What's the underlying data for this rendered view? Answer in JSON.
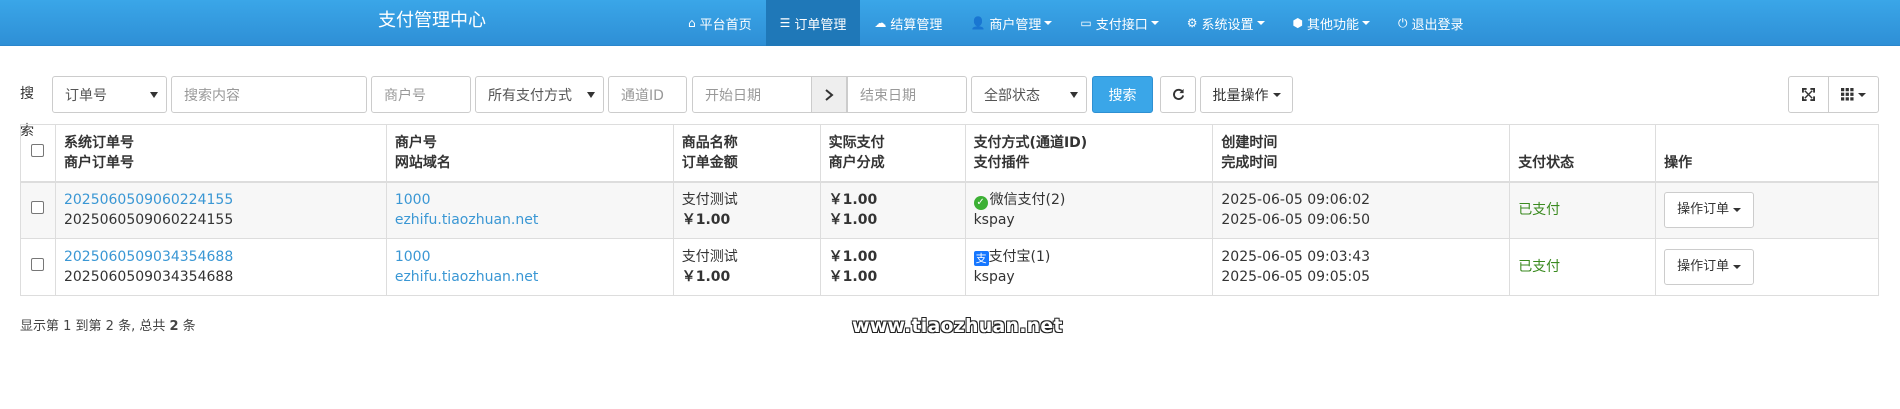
{
  "navbar": {
    "brand": "支付管理中心",
    "items": [
      {
        "label": "平台首页",
        "icon": "home-icon",
        "glyph": "⌂",
        "active": false,
        "caret": false
      },
      {
        "label": "订单管理",
        "icon": "list-icon",
        "glyph": "☰",
        "active": true,
        "caret": false
      },
      {
        "label": "结算管理",
        "icon": "cloud-icon",
        "glyph": "☁",
        "active": false,
        "caret": false
      },
      {
        "label": "商户管理",
        "icon": "user-icon",
        "glyph": "👤",
        "active": false,
        "caret": true
      },
      {
        "label": "支付接口",
        "icon": "credit-card-icon",
        "glyph": "▭",
        "active": false,
        "caret": true
      },
      {
        "label": "系统设置",
        "icon": "gear-icon",
        "glyph": "⚙",
        "active": false,
        "caret": true
      },
      {
        "label": "其他功能",
        "icon": "cube-icon",
        "glyph": "⬢",
        "active": false,
        "caret": true
      },
      {
        "label": "退出登录",
        "icon": "power-icon",
        "glyph": "⏻",
        "active": false,
        "caret": false
      }
    ]
  },
  "toolbar": {
    "search_label": "搜索",
    "field_select": "订单号",
    "keyword_placeholder": "搜索内容",
    "merchant_placeholder": "商户号",
    "paytype_select": "所有支付方式",
    "channel_placeholder": "通道ID",
    "start_placeholder": "开始日期",
    "end_placeholder": "结束日期",
    "status_select": "全部状态",
    "search_button": "搜索",
    "batch_button": "批量操作"
  },
  "table": {
    "headers": [
      {
        "line1": "系统订单号",
        "line2": "商户订单号"
      },
      {
        "line1": "商户号",
        "line2": "网站域名"
      },
      {
        "line1": "商品名称",
        "line2": "订单金额"
      },
      {
        "line1": "实际支付",
        "line2": "商户分成"
      },
      {
        "line1": "支付方式(通道ID)",
        "line2": "支付插件"
      },
      {
        "line1": "创建时间",
        "line2": "完成时间"
      },
      {
        "line1": "支付状态",
        "line2": ""
      },
      {
        "line1": "操作",
        "line2": ""
      }
    ],
    "rows": [
      {
        "trade_no": "2025060509060224155",
        "out_trade_no": "2025060509060224155",
        "uid": "1000",
        "domain": "ezhifu.tiaozhuan.net",
        "name": "支付测试",
        "money": "￥1.00",
        "real_money": "￥1.00",
        "get_money": "￥1.00",
        "pay_type": "微信支付(2)",
        "pay_icon": "wechat-pay-icon",
        "plugin": "kspay",
        "addtime": "2025-06-05 09:06:02",
        "endtime": "2025-06-05 09:06:50",
        "status": "已支付",
        "op_button": "操作订单"
      },
      {
        "trade_no": "2025060509034354688",
        "out_trade_no": "2025060509034354688",
        "uid": "1000",
        "domain": "ezhifu.tiaozhuan.net",
        "name": "支付测试",
        "money": "￥1.00",
        "real_money": "￥1.00",
        "get_money": "￥1.00",
        "pay_type": "支付宝(1)",
        "pay_icon": "alipay-icon",
        "plugin": "kspay",
        "addtime": "2025-06-05 09:03:43",
        "endtime": "2025-06-05 09:05:05",
        "status": "已支付",
        "op_button": "操作订单"
      }
    ]
  },
  "footer": {
    "pre": "显示第 1 到第 2 条, 总共 ",
    "total": "2",
    "post": " 条"
  },
  "watermark": "www.tiaozhuan.net",
  "colors": {
    "navbar": "#3aa6e8",
    "nav_active": "#1f78b8",
    "link": "#3a97d4",
    "paid": "#3a8a1f",
    "primary_button": "#3aa6e8"
  }
}
